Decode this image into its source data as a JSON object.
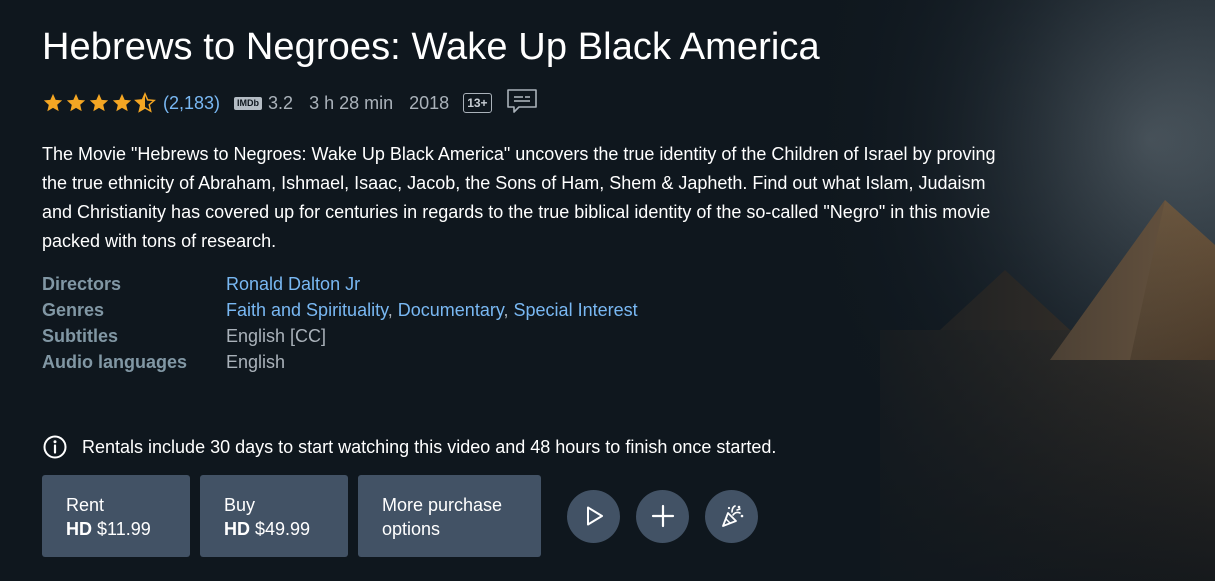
{
  "title": "Hebrews to Negroes: Wake Up Black America",
  "meta": {
    "star_rating": 4.5,
    "rating_count": "(2,183)",
    "imdb_label": "IMDb",
    "imdb_score": "3.2",
    "runtime": "3 h 28 min",
    "year": "2018",
    "maturity_rating": "13+",
    "subtitles_icon": "subtitles-icon"
  },
  "synopsis": "The Movie \"Hebrews to Negroes: Wake Up Black America\" uncovers the true identity of the Children of Israel by proving the true ethnicity of Abraham, Ishmael, Isaac, Jacob, the Sons of Ham, Shem & Japheth. Find out what Islam, Judaism and Christianity has covered up for centuries in regards to the true biblical identity of the so-called \"Negro\" in this movie packed with tons of research.",
  "details": {
    "directors_label": "Directors",
    "directors": [
      "Ronald Dalton Jr"
    ],
    "genres_label": "Genres",
    "genres": [
      "Faith and Spirituality",
      "Documentary",
      "Special Interest"
    ],
    "genre_separator": ",",
    "subtitles_label": "Subtitles",
    "subtitles_value": "English [CC]",
    "audio_label": "Audio languages",
    "audio_value": "English"
  },
  "notice": {
    "icon": "info-icon",
    "text": "Rentals include 30 days to start watching this video and 48 hours to finish once started."
  },
  "actions": {
    "rent": {
      "line1": "Rent",
      "quality": "HD",
      "price": "$11.99"
    },
    "buy": {
      "line1": "Buy",
      "quality": "HD",
      "price": "$49.99"
    },
    "more": {
      "line1": "More purchase",
      "line2": "options"
    },
    "icons": [
      "play-icon",
      "add-icon",
      "party-popper-icon"
    ]
  },
  "colors": {
    "background": "#0f171e",
    "link": "#79b8f3",
    "button": "#425265",
    "star": "#f4a623",
    "label": "#8197a4"
  }
}
